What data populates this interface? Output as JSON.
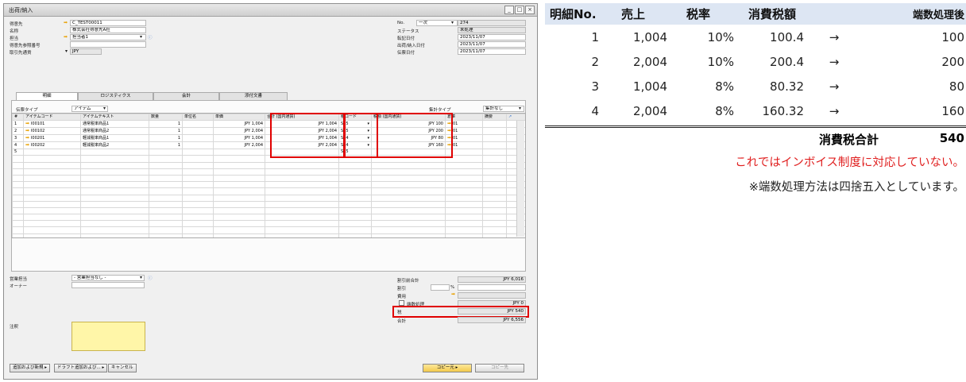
{
  "window": {
    "title": "出荷/納入",
    "btn_min": "_",
    "btn_max": "□",
    "btn_close": "×"
  },
  "header_left": {
    "customer_label": "得意先",
    "customer_value": "C_TEST00011",
    "name_label": "名称",
    "name_value": "株式会社得意先A社",
    "contact_label": "担当",
    "contact_value": "担当者1",
    "ref_label": "得意先参照番号",
    "ref_value": "",
    "currency_label": "取引先通貨",
    "currency_value": "JPY"
  },
  "header_right": {
    "no_label": "No.",
    "series_value": "一次",
    "no_value": "274",
    "status_label": "ステータス",
    "status_value": "未処理",
    "posting_label": "転記日付",
    "posting_value": "2023/11/07",
    "delivery_label": "出荷/納入日付",
    "delivery_value": "2023/11/07",
    "doc_label": "伝票日付",
    "doc_value": "2023/11/07"
  },
  "tabs": [
    "明細",
    "ロジスティクス",
    "会計",
    "添付文書"
  ],
  "doc_type_label": "伝票タイプ",
  "doc_type_value": "アイテム",
  "summary_label": "集計タイプ",
  "summary_value": "集計なし",
  "grid_headers": [
    "#",
    "アイテムコード",
    "アイテムテキスト",
    "数量",
    "単位名",
    "単価",
    "合計 (国内通貨)",
    "税コード",
    "税額 (国内通貨)",
    "倉庫",
    "摘要"
  ],
  "grid_rows": [
    [
      "1",
      "I00101",
      "通常税率商品1",
      "1",
      "",
      "JPY 1,004",
      "JPY 1,004",
      "S05",
      "JPY 100",
      "01",
      ""
    ],
    [
      "2",
      "I00102",
      "通常税率商品2",
      "1",
      "",
      "JPY 2,004",
      "JPY 2,004",
      "S05",
      "JPY 200",
      "01",
      ""
    ],
    [
      "3",
      "I00201",
      "軽減税率商品1",
      "1",
      "",
      "JPY 1,004",
      "JPY 1,004",
      "S04",
      "JPY 80",
      "01",
      ""
    ],
    [
      "4",
      "I00202",
      "軽減税率商品2",
      "1",
      "",
      "JPY 2,004",
      "JPY 2,004",
      "S04",
      "JPY 160",
      "01",
      ""
    ],
    [
      "5",
      "",
      "",
      "",
      "",
      "",
      "",
      "S05",
      "",
      "",
      ""
    ]
  ],
  "footer": {
    "sales_rep_label": "営業担当",
    "sales_rep_value": "- 営業担当なし -",
    "owner_label": "オーナー",
    "remarks_label": "注釈",
    "before_disc_label": "割引前合計",
    "before_disc_value": "JPY 6,016",
    "disc_label": "割引",
    "disc_pct": "%",
    "freight_label": "費用",
    "rounding_label": "端数処理",
    "rounding_value": "JPY 0",
    "tax_label": "税",
    "tax_value": "JPY 540",
    "total_label": "合計",
    "total_value": "JPY 6,556"
  },
  "buttons": {
    "add": "追加および新規",
    "draft": "ドラフト追加および...",
    "cancel": "キャンセル",
    "copy_from": "コピー元",
    "copy_to": "コピー先"
  },
  "right_table": {
    "headers": [
      "明細No.",
      "売上",
      "税率",
      "消費税額",
      "",
      "端数処理後"
    ],
    "rows": [
      [
        "1",
        "1,004",
        "10%",
        "100.4",
        "→",
        "100"
      ],
      [
        "2",
        "2,004",
        "10%",
        "200.4",
        "→",
        "200"
      ],
      [
        "3",
        "1,004",
        "8%",
        "80.32",
        "→",
        "80"
      ],
      [
        "4",
        "2,004",
        "8%",
        "160.32",
        "→",
        "160"
      ]
    ],
    "total_label": "消費税合計",
    "total_value": "540"
  },
  "annotation_red": "これではインボイス制度に対応していない。",
  "annotation_note": "※端数処理方法は四捨五入としています。"
}
